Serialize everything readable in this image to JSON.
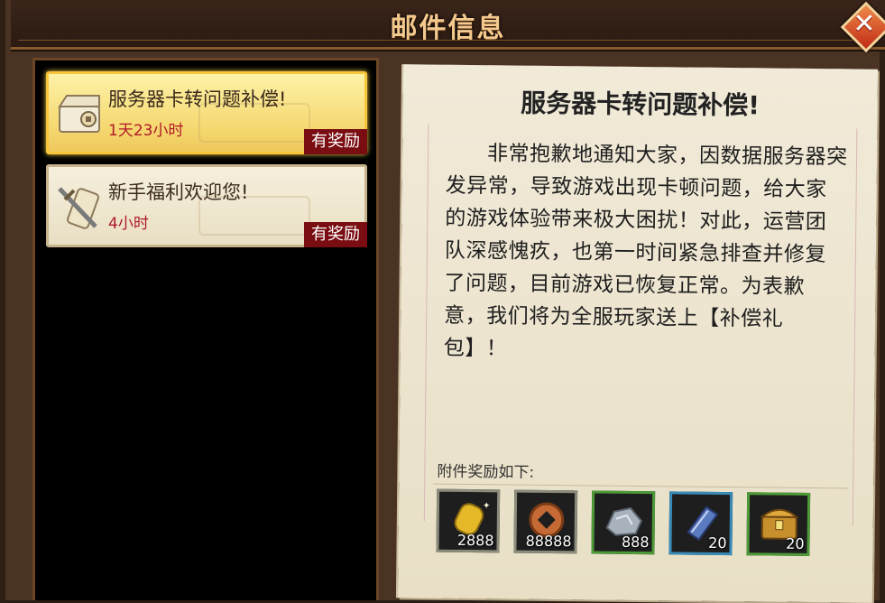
{
  "window": {
    "title": "邮件信息",
    "close_icon": "close-icon"
  },
  "mail_list": [
    {
      "subject": "服务器卡转问题补偿!",
      "time": "1天23小时",
      "tag": "有奖励",
      "icon": "chest-icon",
      "selected": true
    },
    {
      "subject": "新手福利欢迎您!",
      "time": "4小时",
      "tag": "有奖励",
      "icon": "scroll-sword-icon",
      "selected": false
    }
  ],
  "letter": {
    "title": "服务器卡转问题补偿!",
    "body": "非常抱歉地通知大家，因数据服务器突发异常，导致游戏出现卡顿问题，给大家的游戏体验带来极大困扰！对此，运营团队深感愧疚，也第一时间紧急排查并修复了问题，目前游戏已恢复正常。为表歉意，我们将为全服玩家送上【补偿礼包】！",
    "attachments_label": "附件奖励如下:",
    "attachments": [
      {
        "icon": "gold-ingot-icon",
        "qty": "2888",
        "rarity": "grey"
      },
      {
        "icon": "copper-coin-icon",
        "qty": "88888",
        "rarity": "grey"
      },
      {
        "icon": "silver-ore-icon",
        "qty": "888",
        "rarity": "green"
      },
      {
        "icon": "blue-book-icon",
        "qty": "20",
        "rarity": "blue"
      },
      {
        "icon": "treasure-chest-icon",
        "qty": "20",
        "rarity": "green"
      }
    ]
  },
  "colors": {
    "title_text": "#f4c98e",
    "time_text": "#b01828",
    "tag_bg": "#7a0d12",
    "selected_bg": "#f5d870"
  }
}
